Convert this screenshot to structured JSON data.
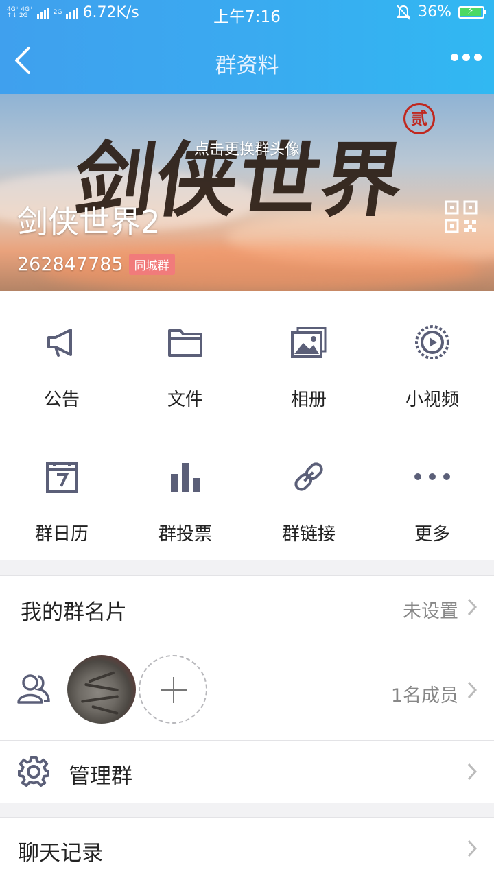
{
  "status_bar": {
    "signal_a": "4G⁺ 4G⁺",
    "signal_b": "↑↓ 2G",
    "signal_c": "2G",
    "speed": "6.72K/s",
    "time": "上午7:16",
    "battery": "36%"
  },
  "nav": {
    "title": "群资料"
  },
  "banner": {
    "calligraphy": "剑侠世界",
    "seal": "贰",
    "change_avatar_hint": "点击更换群头像",
    "group_name": "剑侠世界2",
    "group_id": "262847785",
    "badge": "同城群"
  },
  "functions": [
    {
      "label": "公告",
      "icon": "megaphone-icon"
    },
    {
      "label": "文件",
      "icon": "folder-icon"
    },
    {
      "label": "相册",
      "icon": "photo-album-icon"
    },
    {
      "label": "小视频",
      "icon": "video-play-icon"
    },
    {
      "label": "群日历",
      "icon": "calendar-icon"
    },
    {
      "label": "群投票",
      "icon": "bar-chart-icon"
    },
    {
      "label": "群链接",
      "icon": "link-icon"
    },
    {
      "label": "更多",
      "icon": "more-dots-icon"
    }
  ],
  "my_card": {
    "title": "我的群名片",
    "value": "未设置"
  },
  "members": {
    "count": "1名成员"
  },
  "manage": {
    "title": "管理群"
  },
  "chat_history": {
    "title": "聊天记录"
  },
  "colors": {
    "header_start": "#3fa0ee",
    "header_end": "#31b8f2",
    "icon": "#5b5f78",
    "badge": "#f17b7b"
  }
}
